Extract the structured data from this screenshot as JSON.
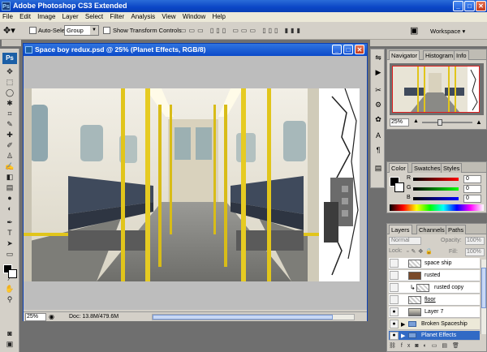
{
  "app": {
    "title": "Adobe Photoshop CS3 Extended",
    "icon_label": "Ps",
    "window_buttons": {
      "minimize": "_",
      "maximize": "□",
      "close": "✕"
    }
  },
  "menu": [
    "File",
    "Edit",
    "Image",
    "Layer",
    "Select",
    "Filter",
    "Analysis",
    "View",
    "Window",
    "Help"
  ],
  "options": {
    "auto_select_label": "Auto-Select:",
    "auto_select_value": "Group",
    "show_transform_label": "Show Transform Controls",
    "workspace_label": "Workspace ▾"
  },
  "tools": {
    "logo": "Ps"
  },
  "document": {
    "title": "Space boy redux.psd @ 25% (Planet Effects, RGB/8)",
    "zoom": "25%",
    "doc_info": "Doc: 13.8M/479.6M"
  },
  "navigator": {
    "tabs": [
      "Navigator",
      "Histogram",
      "Info"
    ],
    "zoom": "25%",
    "slider_fraction": 0.35
  },
  "color": {
    "tabs": [
      "Color",
      "Swatches",
      "Styles"
    ],
    "channels": [
      {
        "label": "R",
        "value": "0"
      },
      {
        "label": "G",
        "value": "0"
      },
      {
        "label": "B",
        "value": "0"
      }
    ]
  },
  "layers": {
    "tabs": [
      "Layers",
      "Channels",
      "Paths"
    ],
    "blend_mode": "Normal",
    "opacity_label": "Opacity:",
    "opacity_value": "100%",
    "lock_label": "Lock:",
    "fill_label": "Fill:",
    "fill_value": "100%",
    "items": [
      {
        "name": "space ship",
        "selected": false
      },
      {
        "name": "rusted",
        "selected": false
      },
      {
        "name": "rusted copy",
        "selected": false
      },
      {
        "name": "floor",
        "selected": false
      },
      {
        "name": "Layer 7",
        "selected": false
      },
      {
        "name": "Broken Spaceship",
        "selected": false
      },
      {
        "name": "Planet Effects",
        "selected": true
      }
    ]
  },
  "colors": {
    "accent": "#316ac5",
    "titlebar": "#0b46c6",
    "panel": "#d4d0c8"
  }
}
